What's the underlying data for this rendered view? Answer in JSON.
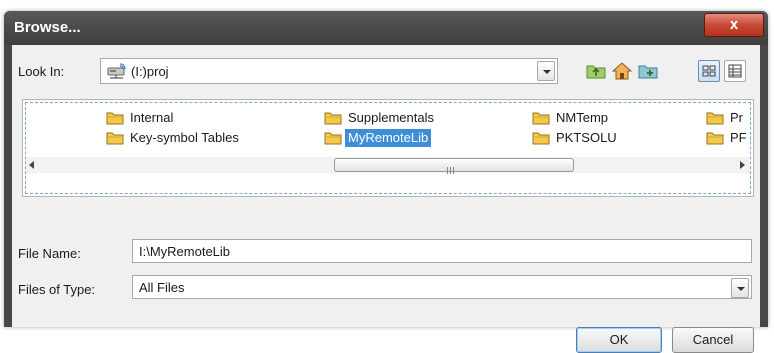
{
  "dialog": {
    "title": "Browse...",
    "close_label": "x"
  },
  "look_in": {
    "label": "Look In:",
    "value": "(I:)proj",
    "icon": "network-drive-icon"
  },
  "toolbar": {
    "icons": [
      "up-folder-icon",
      "home-icon",
      "new-folder-icon"
    ],
    "views": [
      "list-view-icon",
      "details-view-icon"
    ],
    "active_view": "list-view-icon"
  },
  "files": {
    "items": [
      {
        "name": "Internal",
        "selected": false
      },
      {
        "name": "Key-symbol Tables",
        "selected": false
      },
      {
        "name": "Supplementals",
        "selected": false
      },
      {
        "name": "MyRemoteLib",
        "selected": true
      },
      {
        "name": "NMTemp",
        "selected": false
      },
      {
        "name": "PKTSOLU",
        "selected": false
      },
      {
        "name": "Pr",
        "selected": false
      },
      {
        "name": "PF",
        "selected": false
      }
    ]
  },
  "file_name": {
    "label": "File Name:",
    "value": "I:\\MyRemoteLib"
  },
  "file_type": {
    "label": "Files of Type:",
    "value": "All Files"
  },
  "buttons": {
    "ok": "OK",
    "cancel": "Cancel"
  },
  "colors": {
    "titlebar": "#474747",
    "close_button": "#c84a36",
    "selection": "#3d8ed6",
    "folder": "#f2c94c"
  }
}
